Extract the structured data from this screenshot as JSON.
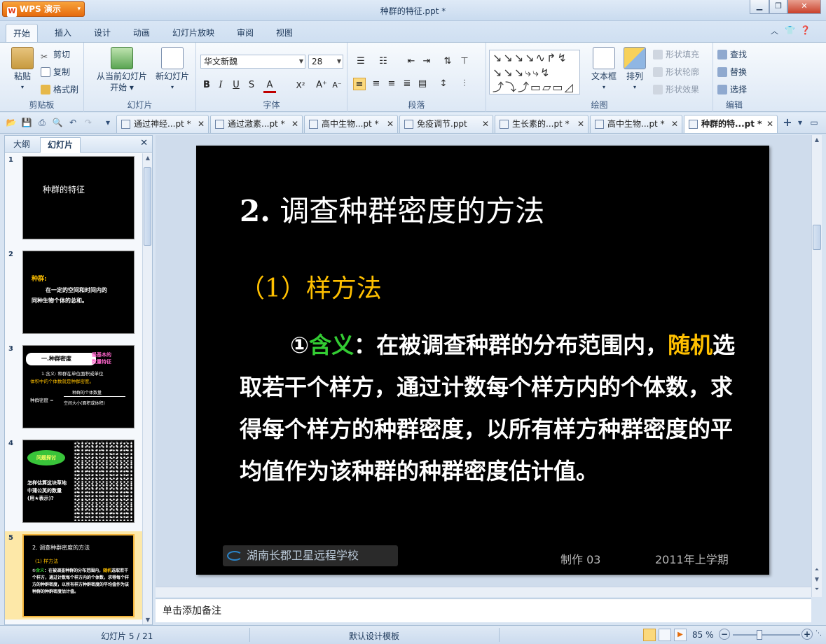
{
  "app": {
    "name": "WPS 演示",
    "window_title": "种群的特征.ppt *"
  },
  "ribbon_tabs": [
    "开始",
    "插入",
    "设计",
    "动画",
    "幻灯片放映",
    "审阅",
    "视图"
  ],
  "clipboard": {
    "paste": "粘贴",
    "cut": "剪切",
    "copy": "复制",
    "format_painter": "格式刷",
    "label": "剪贴板"
  },
  "slides_group": {
    "from_current_line1": "从当前幻灯片",
    "from_current_line2": "开始",
    "new_slide": "新幻灯片",
    "label": "幻灯片"
  },
  "font_group": {
    "font_name": "华文新魏",
    "font_size": "28",
    "label": "字体"
  },
  "paragraph_group": {
    "label": "段落"
  },
  "drawing_group": {
    "textbox": "文本框",
    "arrange": "排列",
    "shape_fill": "形状填充",
    "shape_outline": "形状轮廓",
    "shape_effect": "形状效果",
    "label": "绘图"
  },
  "edit_group": {
    "find": "查找",
    "replace": "替换",
    "select": "选择",
    "label": "编辑"
  },
  "doc_tabs": [
    "通过神经...pt *",
    "通过激素...pt *",
    "高中生物...pt *",
    "免疫调节.ppt",
    "生长素的...pt *",
    "高中生物...pt *",
    "种群的特...pt *"
  ],
  "panel_tabs": {
    "outline": "大纲",
    "slides": "幻灯片"
  },
  "thumbnails": {
    "t1_title": "种群的特征",
    "t2_term": "种群:",
    "t2_def1": "在一定的空间和时间内的",
    "t2_def2": "同种生物个体的总和。",
    "t3_heading": "一.种群密度",
    "t3_tag1": "最基本的",
    "t3_tag2": "数量特征",
    "t3_line1": "1.含义: 种群在单位面积或单位",
    "t3_line2": "体积中的个体数就是种群密度。",
    "t3_formula_left": "种群密度 =",
    "t3_formula_top": "种群的个体数量",
    "t3_formula_bottom": "空间大小(面积或体积)",
    "t4_bubble": "问题探讨",
    "t4_text": "怎样估算这块草地中蒲公英的数量(用★表示)?",
    "t5_title": "2. 调查种群密度的方法",
    "t5_sub": "(1) 样方法"
  },
  "slide": {
    "title_num": "2.",
    "title_text": " 调查种群密度的方法",
    "subtitle": "（1）样方法",
    "body_lead": "①",
    "body_term": "含义",
    "body_p1": "：在被调查种群的分布范围内，",
    "body_highlight": "随机",
    "body_p2": "选取若干个样方，通过计数每个样方内的个体数，求得每个样方的种群密度，以所有样方种群密度的平均值作为该种群的种群密度估计值。",
    "footer_school": "湖南长郡卫星远程学校",
    "footer_made": "制作  03",
    "footer_term": "2011年上学期"
  },
  "notes_placeholder": "单击添加备注",
  "status": {
    "slide_counter": "幻灯片 5 / 21",
    "template": "默认设计模板",
    "zoom": "85 %"
  }
}
